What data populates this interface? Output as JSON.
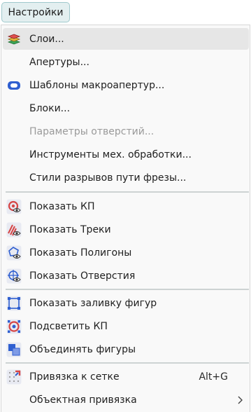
{
  "menu_button": {
    "label": "Настройки"
  },
  "menu": {
    "items": [
      {
        "label": "Слои...",
        "icon": "layers-icon"
      },
      {
        "label": "Апертуры...",
        "icon": ""
      },
      {
        "label": "Шаблоны макроапертур...",
        "icon": "macro-aperture-icon"
      },
      {
        "label": "Блоки...",
        "icon": ""
      },
      {
        "label": "Параметры отверстий...",
        "icon": "",
        "disabled": true
      },
      {
        "label": "Инструменты мех. обработки...",
        "icon": ""
      },
      {
        "label": "Стили разрывов пути фрезы...",
        "icon": ""
      },
      {
        "label": "Показать КП",
        "icon": "show-pads-icon"
      },
      {
        "label": "Показать Треки",
        "icon": "show-tracks-icon"
      },
      {
        "label": "Показать Полигоны",
        "icon": "show-polygons-icon"
      },
      {
        "label": "Показать Отверстия",
        "icon": "show-holes-icon"
      },
      {
        "label": "Показать заливку фигур",
        "icon": "shape-fill-icon"
      },
      {
        "label": "Подсветить КП",
        "icon": "highlight-pads-icon"
      },
      {
        "label": "Объединять фигуры",
        "icon": "merge-shapes-icon"
      },
      {
        "label": "Привязка к сетке",
        "icon": "grid-snap-icon",
        "shortcut": "Alt+G"
      },
      {
        "label": "Объектная привязка",
        "icon": "",
        "submenu": true
      }
    ]
  },
  "colors": {
    "accent": "#9fc9cc",
    "highlight": "#e6e6e6",
    "icon_blue": "#2f5fd0",
    "icon_red": "#d64545"
  }
}
